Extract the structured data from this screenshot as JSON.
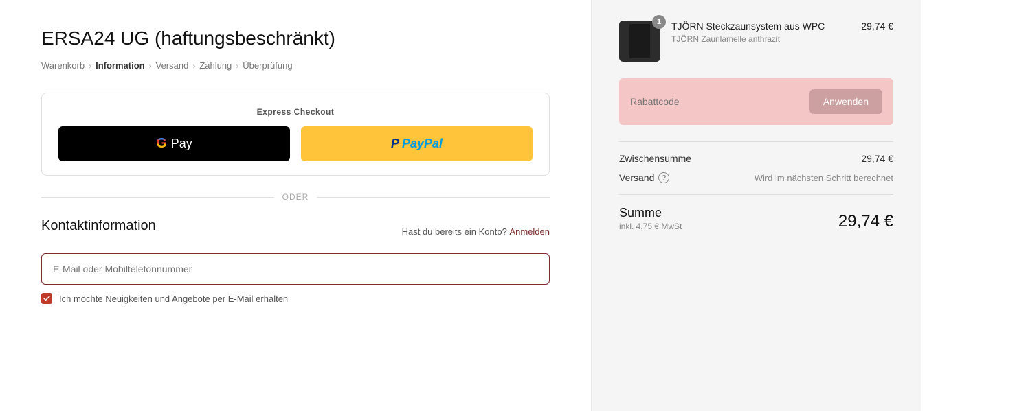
{
  "store": {
    "name": "ERSA24 UG (haftungsbeschränkt)"
  },
  "breadcrumb": {
    "items": [
      {
        "label": "Warenkorb",
        "active": false
      },
      {
        "label": "Information",
        "active": true
      },
      {
        "label": "Versand",
        "active": false
      },
      {
        "label": "Zahlung",
        "active": false
      },
      {
        "label": "Überprüfung",
        "active": false
      }
    ],
    "separator": "›"
  },
  "express_checkout": {
    "label": "Express Checkout",
    "gpay_label": "Pay",
    "paypal_label": "PayPal"
  },
  "oder_label": "ODER",
  "contact_section": {
    "title": "Kontaktinformation",
    "login_text": "Hast du bereits ein Konto?",
    "login_link": "Anmelden",
    "email_placeholder": "E-Mail oder Mobiltelefonnummer",
    "newsletter_text": "Ich möchte Neuigkeiten und Angebote per E-Mail erhalten"
  },
  "order_summary": {
    "product": {
      "badge": "1",
      "name": "TJÖRN Steckzaunsystem aus WPC",
      "subtitle": "TJÖRN Zaunlamelle anthrazit",
      "price": "29,74 €"
    },
    "discount": {
      "placeholder": "Rabattcode",
      "button_label": "Anwenden"
    },
    "subtotal_label": "Zwischensumme",
    "subtotal_value": "29,74 €",
    "shipping_label": "Versand",
    "shipping_value": "Wird im nächsten Schritt berechnet",
    "total_label": "Summe",
    "total_sublabel": "inkl. 4,75 € MwSt",
    "total_value": "29,74 €"
  }
}
